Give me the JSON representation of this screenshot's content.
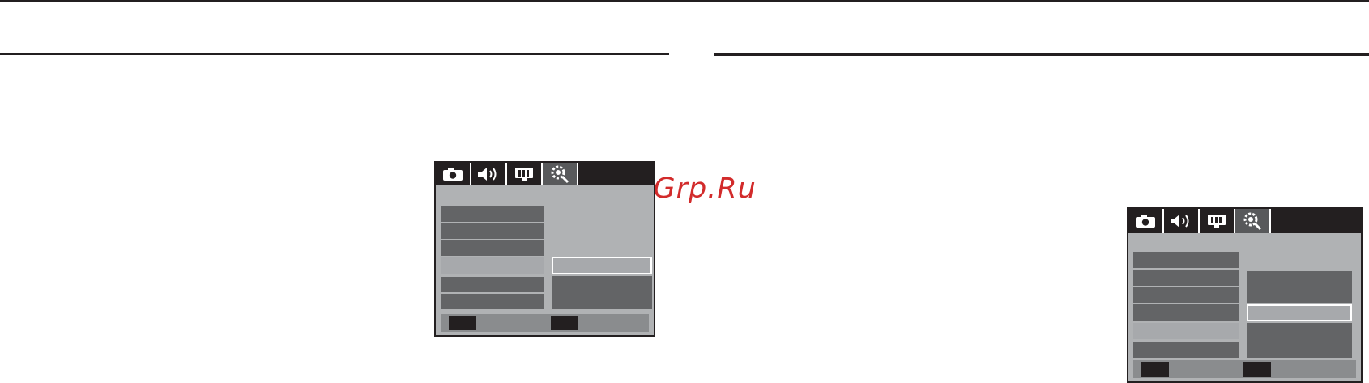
{
  "watermark": {
    "text": "McGrp.Ru"
  },
  "colors": {
    "rule": "#231f20",
    "watermark": "#d22b2b",
    "lcd_background": "#b0b2b4",
    "menu_item": "#636466",
    "menu_item_selected": "#a7a9ac",
    "highlight_border": "#ffffff"
  },
  "left_screen": {
    "tabs": [
      {
        "icon": "camera-icon",
        "selected": false
      },
      {
        "icon": "speaker-icon",
        "selected": false
      },
      {
        "icon": "display-icon",
        "selected": false
      },
      {
        "icon": "gear-icon",
        "selected": true
      }
    ],
    "selected_menu_row": 4,
    "highlighted_option": 1
  },
  "right_screen": {
    "tabs": [
      {
        "icon": "camera-icon",
        "selected": false
      },
      {
        "icon": "speaker-icon",
        "selected": false
      },
      {
        "icon": "display-icon",
        "selected": false
      },
      {
        "icon": "gear-icon",
        "selected": true
      }
    ],
    "selected_menu_row": 5,
    "highlighted_option": 2
  }
}
